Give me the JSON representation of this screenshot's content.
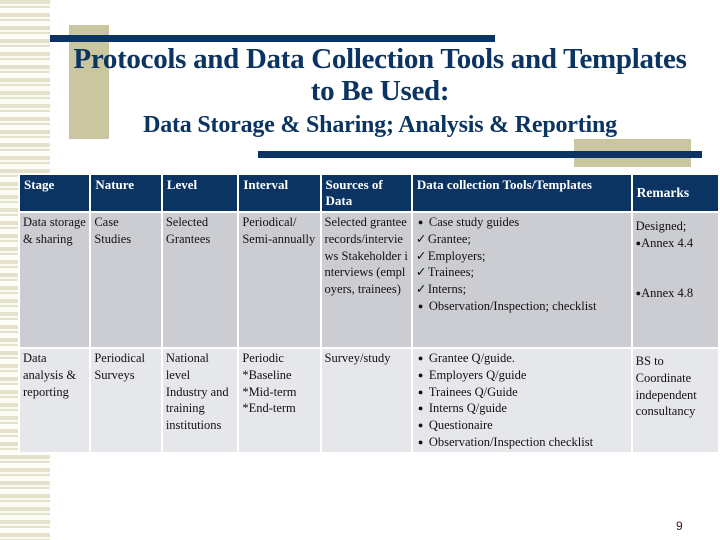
{
  "slide": {
    "title": "Protocols and Data Collection Tools and Templates to Be Used:",
    "subtitle": "Data Storage & Sharing; Analysis & Reporting",
    "page_number": "9",
    "colors": {
      "navy": "#0b3463",
      "tan": "#c9c6a0",
      "row1": "#cbcdd2",
      "row2": "#e6e7ea"
    }
  },
  "table": {
    "headers": [
      "Stage",
      "Nature",
      "Level",
      "Interval",
      "Sources of Data",
      "Data collection Tools/Templates",
      "Remarks"
    ],
    "rows": [
      {
        "stage": "Data storage & sharing",
        "nature": "Case Studies",
        "level": "Selected Grantees",
        "interval": "Periodical/ Semi-annually",
        "sources": "Selected grantee records/interviews Stakeholder interviews (employers, trainees)",
        "tools": [
          {
            "marker": "bullet-icon",
            "text": "Case study guides"
          },
          {
            "marker": "check-icon",
            "text": "Grantee;"
          },
          {
            "marker": "check-icon",
            "text": "Employers;"
          },
          {
            "marker": "check-icon",
            "text": "Trainees;"
          },
          {
            "marker": "check-icon",
            "text": "Interns;"
          },
          {
            "marker": "bullet-icon",
            "text": "Observation/Inspection; checklist"
          }
        ],
        "remarks": [
          "Designed;",
          "Annex 4.4",
          "Annex 4.8"
        ]
      },
      {
        "stage": "Data analysis & reporting",
        "nature": "Periodical Surveys",
        "level": "National level Industry and training institutions",
        "interval": [
          "Periodic",
          "*Baseline",
          "*Mid-term",
          "*End-term"
        ],
        "sources": "Survey/study",
        "tools": [
          {
            "marker": "bullet-icon",
            "text": "Grantee Q/guide."
          },
          {
            "marker": "bullet-icon",
            "text": "Employers Q/guide"
          },
          {
            "marker": "bullet-icon",
            "text": "Trainees Q/Guide"
          },
          {
            "marker": "bullet-icon",
            "text": "Interns Q/guide"
          },
          {
            "marker": "bullet-icon",
            "text": "Questionaire"
          },
          {
            "marker": "bullet-icon",
            "text": "Observation/Inspection checklist"
          }
        ],
        "remarks": [
          "BS to Coordinate independent consultancy"
        ]
      }
    ]
  },
  "icons": {
    "bullet-icon": "•",
    "check-icon": "✓"
  }
}
